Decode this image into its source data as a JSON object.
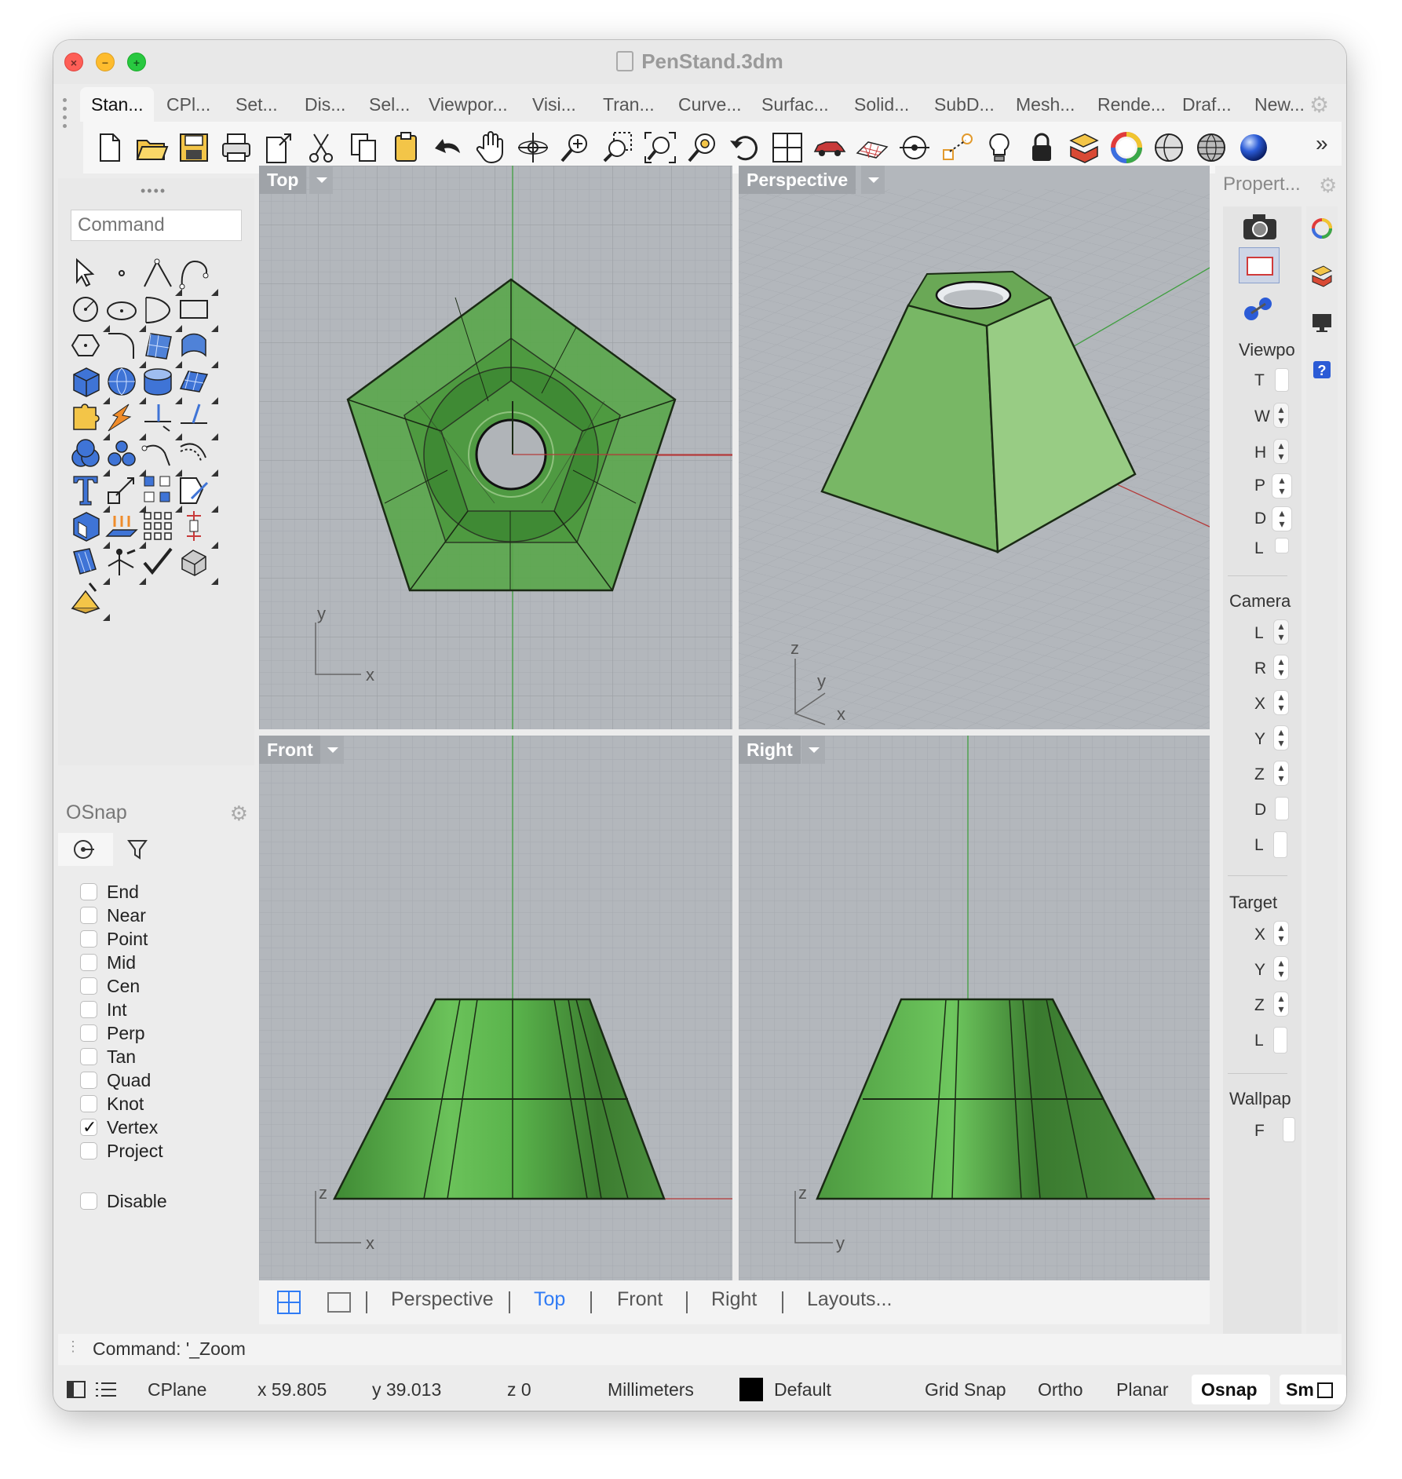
{
  "window": {
    "title": "PenStand.3dm"
  },
  "traffic": {
    "close": "×",
    "minimize": "−",
    "maximize": "+"
  },
  "tabs": [
    {
      "label": "Stan...",
      "active": true
    },
    {
      "label": "CPl..."
    },
    {
      "label": "Set..."
    },
    {
      "label": "Dis..."
    },
    {
      "label": "Sel..."
    },
    {
      "label": "Viewpor..."
    },
    {
      "label": "Visi..."
    },
    {
      "label": "Tran..."
    },
    {
      "label": "Curve..."
    },
    {
      "label": "Surfac..."
    },
    {
      "label": "Solid..."
    },
    {
      "label": "SubD..."
    },
    {
      "label": "Mesh..."
    },
    {
      "label": "Rende..."
    },
    {
      "label": "Draf..."
    },
    {
      "label": "New..."
    }
  ],
  "toolbar": {
    "icons": [
      "new-file-icon",
      "open-folder-icon",
      "save-icon",
      "print-icon",
      "export-icon",
      "cut-icon",
      "copy-icon",
      "paste-icon",
      "undo-icon",
      "pan-hand-icon",
      "rotate-view-icon",
      "zoom-icon",
      "zoom-window-icon",
      "zoom-extents-icon",
      "zoom-selected-icon",
      "undo-view-icon",
      "four-viewports-icon",
      "car-icon",
      "plane-grid-icon",
      "cplane-icon",
      "object-snap-icon",
      "light-bulb-icon",
      "lock-icon",
      "layers-icon",
      "color-wheel-icon",
      "shaded-sphere-icon",
      "wireframe-sphere-icon",
      "render-sphere-icon"
    ],
    "more": "»"
  },
  "command": {
    "placeholder": "Command"
  },
  "tool_palette": [
    "select-arrow-icon",
    "point-icon",
    "polyline-icon",
    "curve-icon",
    "circle-icon",
    "ellipse-icon",
    "arc-icon",
    "rectangle-icon",
    "polygon-icon",
    "fillet-icon",
    "surface-icon",
    "sweep-icon",
    "box-icon",
    "sphere-icon",
    "cylinder-icon",
    "plane-surface-icon",
    "puzzle-join-icon",
    "explode-icon",
    "trim-icon",
    "split-icon",
    "boolean-union-icon",
    "group-icon",
    "extend-icon",
    "offset-icon",
    "text-icon",
    "scale-icon",
    "array-icon",
    "transform-icon",
    "solid-edit-icon",
    "extrude-icon",
    "grid-array-icon",
    "dimension-icon",
    "align-icon",
    "gumball-icon",
    "check-icon",
    "mesh-icon",
    "drafting-icon"
  ],
  "osnap": {
    "title": "OSnap",
    "items": [
      {
        "label": "End",
        "checked": false
      },
      {
        "label": "Near",
        "checked": false
      },
      {
        "label": "Point",
        "checked": false
      },
      {
        "label": "Mid",
        "checked": false
      },
      {
        "label": "Cen",
        "checked": false
      },
      {
        "label": "Int",
        "checked": false
      },
      {
        "label": "Perp",
        "checked": false
      },
      {
        "label": "Tan",
        "checked": false
      },
      {
        "label": "Quad",
        "checked": false
      },
      {
        "label": "Knot",
        "checked": false
      },
      {
        "label": "Vertex",
        "checked": true
      },
      {
        "label": "Project",
        "checked": false
      }
    ],
    "disable": {
      "label": "Disable",
      "checked": false
    }
  },
  "viewports": {
    "top": {
      "label": "Top",
      "axis_x": "x",
      "axis_y": "y"
    },
    "perspective": {
      "label": "Perspective",
      "axis_x": "x",
      "axis_y": "y",
      "axis_z": "z"
    },
    "front": {
      "label": "Front",
      "axis_x": "x",
      "axis_z": "z"
    },
    "right": {
      "label": "Right",
      "axis_y": "y",
      "axis_z": "z"
    }
  },
  "viewport_tabs": {
    "items": [
      "Perspective",
      "Top",
      "Front",
      "Right",
      "Layouts..."
    ],
    "active": "Top"
  },
  "properties": {
    "title": "Propert...",
    "sections": {
      "viewport": {
        "label": "Viewpo",
        "rows": [
          "T",
          "W",
          "H",
          "P",
          "D",
          "L"
        ]
      },
      "camera": {
        "label": "Camera",
        "rows": [
          "L",
          "R",
          "X",
          "Y",
          "Z",
          "D",
          "L"
        ]
      },
      "target": {
        "label": "Target",
        "rows": [
          "X",
          "Y",
          "Z",
          "L"
        ]
      },
      "wallpaper": {
        "label": "Wallpap",
        "rows": [
          "F"
        ]
      }
    }
  },
  "command_line": {
    "text": "Command: '_Zoom"
  },
  "status": {
    "cplane": "CPlane",
    "x": "x 59.805",
    "y": "y 39.013",
    "z": "z 0",
    "units": "Millimeters",
    "layer": "Default",
    "layer_color": "#000000",
    "grid_snap": "Grid Snap",
    "ortho": "Ortho",
    "planar": "Planar",
    "osnap": "Osnap",
    "smart_track": "Sm"
  },
  "colors": {
    "viewport_bg": "#b3b7bc",
    "object_green": "#5fb14a",
    "object_light_green": "#98cc84",
    "active_tab": "#2f7bf5",
    "x_axis": "#b43a3a",
    "y_axis": "#3f9f3f"
  }
}
